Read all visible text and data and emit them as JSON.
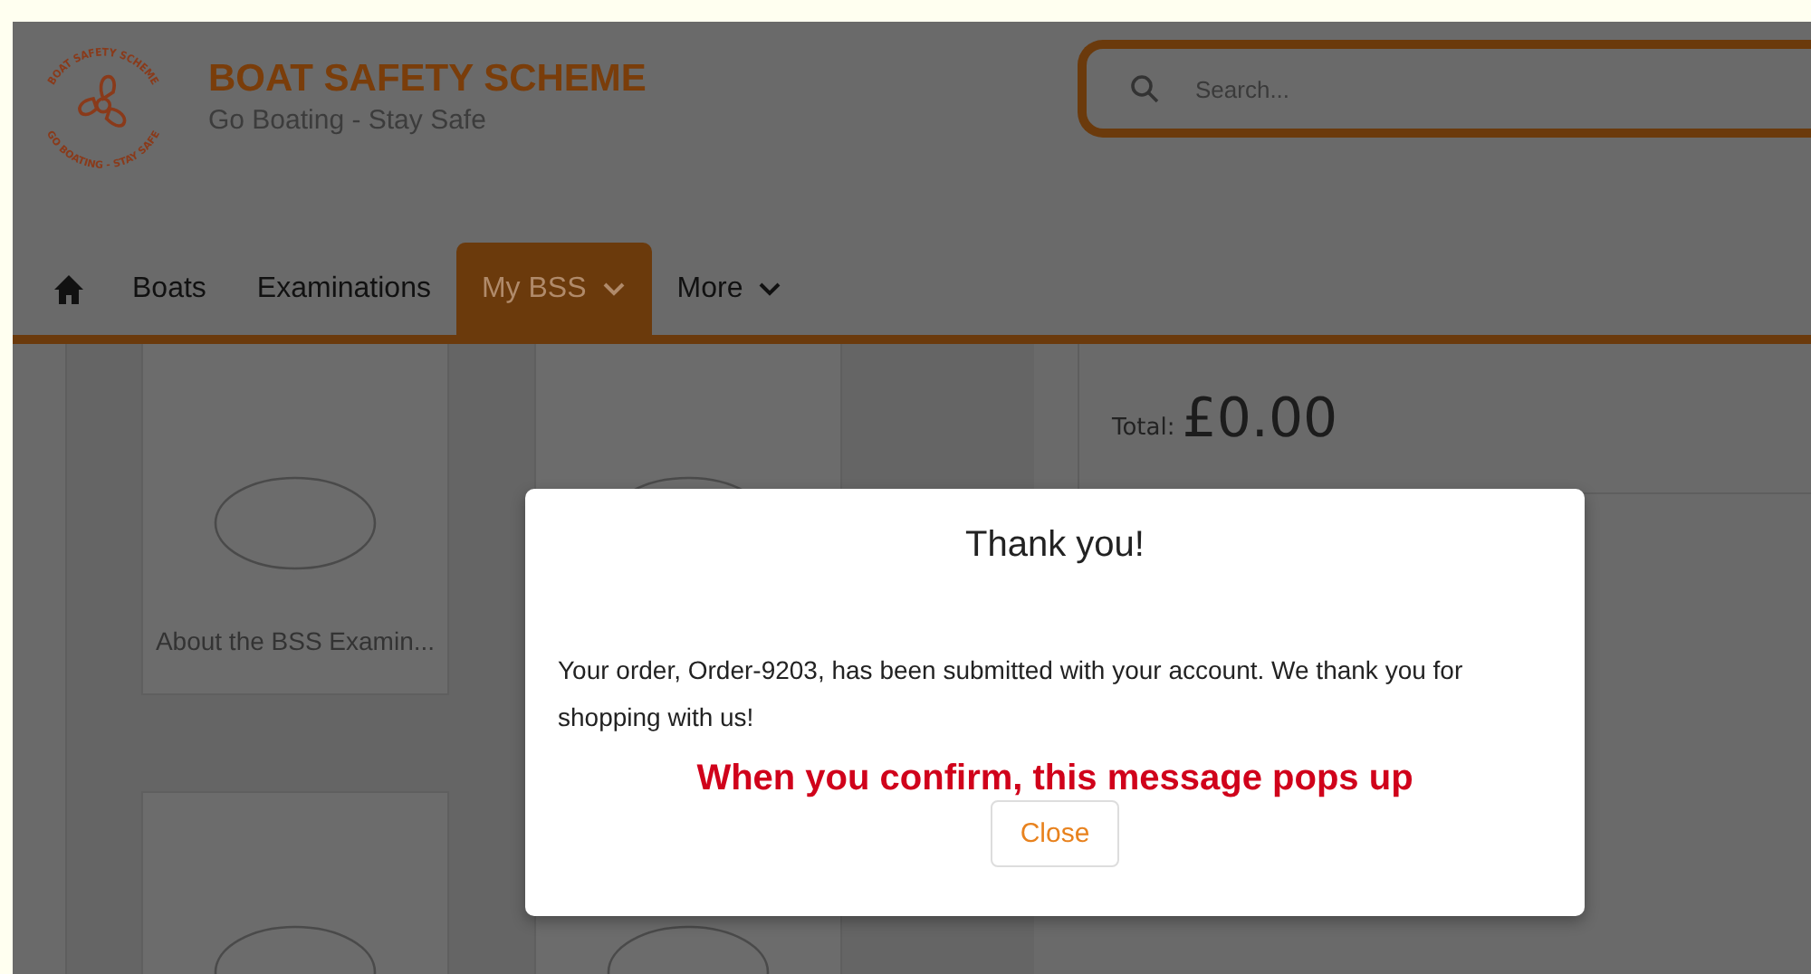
{
  "header": {
    "logo_ring": {
      "top": "BOAT SAFETY SCHEME",
      "bottom": "GO BOATING - STAY SAFE"
    },
    "title": "BOAT SAFETY SCHEME",
    "tagline": "Go Boating - Stay Safe",
    "search": {
      "placeholder": "Search..."
    }
  },
  "nav": [
    {
      "label": "Boats",
      "selected": false,
      "has_menu": false
    },
    {
      "label": "Examinations",
      "selected": false,
      "has_menu": false
    },
    {
      "label": "My BSS",
      "selected": true,
      "has_menu": true
    },
    {
      "label": "More",
      "selected": false,
      "has_menu": true
    }
  ],
  "products": [
    {
      "kind": "no_image",
      "title": "About the BSS Examin..."
    },
    {
      "kind": "no_image"
    },
    {
      "kind": "no_image"
    },
    {
      "kind": "no_image"
    }
  ],
  "cart": {
    "total_label": "Total:",
    "total": "£0.00"
  },
  "dialog": {
    "title": "Thank you!",
    "message": "Your order, Order-9203, has been submitted with your account. We thank you for shopping with us!",
    "button": "Close"
  },
  "annotation": "When you confirm, this message pops up"
}
